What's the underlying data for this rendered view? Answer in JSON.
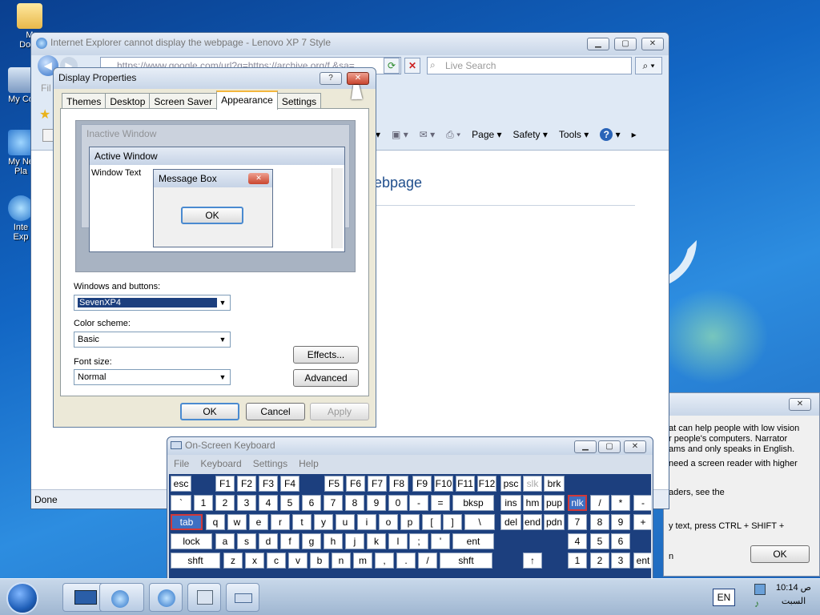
{
  "desktop": {
    "icons": [
      {
        "label": "My Documents",
        "short": "M\nDocu"
      },
      {
        "label": "My Computer",
        "short": "My Co"
      },
      {
        "label": "My Network Places",
        "short": "My Ne\nPla"
      },
      {
        "label": "Internet Explorer",
        "short": "Inte\nExp"
      }
    ]
  },
  "ie": {
    "title": "Internet Explorer cannot display the webpage - Lenovo XP 7 Style",
    "address": "https://www.google.com/url?q=https://archive.org/f &sa=",
    "search_placeholder": "Live Search",
    "file_menu_fragment": "Fil",
    "cmd": {
      "page": "Page",
      "safety": "Safety",
      "tools": "Tools",
      "help": "?"
    },
    "heading_fragment": "ebpage",
    "status": "Done"
  },
  "narrator": {
    "lines": [
      "at can help people with low vision",
      "r people's computers. Narrator",
      "ams and only speaks in English.",
      "need a screen reader with higher",
      "aders, see the",
      "y text, press CTRL + SHIFT +",
      "n"
    ],
    "ok_label": "OK",
    "close_label": "✕"
  },
  "display_properties": {
    "title": "Display Properties",
    "help_label": "?",
    "close_label": "✕",
    "tabs": [
      "Themes",
      "Desktop",
      "Screen Saver",
      "Appearance",
      "Settings"
    ],
    "active_tab": "Appearance",
    "preview": {
      "inactive_title": "Inactive Window",
      "active_title": "Active Window",
      "window_text": "Window Text",
      "message_title": "Message Box",
      "message_ok": "OK"
    },
    "windows_buttons_label": "Windows and buttons:",
    "windows_buttons_value": "SevenXP4",
    "color_scheme_label": "Color scheme:",
    "color_scheme_value": "Basic",
    "font_size_label": "Font size:",
    "font_size_value": "Normal",
    "effects_label": "Effects...",
    "advanced_label": "Advanced",
    "ok_label": "OK",
    "cancel_label": "Cancel",
    "apply_label": "Apply"
  },
  "osk": {
    "title": "On-Screen Keyboard",
    "menu": [
      "File",
      "Keyboard",
      "Settings",
      "Help"
    ],
    "rows": [
      [
        "esc",
        "F1",
        "F2",
        "F3",
        "F4",
        "F5",
        "F6",
        "F7",
        "F8",
        "F9",
        "F10",
        "F11",
        "F12",
        "psc",
        "slk",
        "brk"
      ],
      [
        "`",
        "1",
        "2",
        "3",
        "4",
        "5",
        "6",
        "7",
        "8",
        "9",
        "0",
        "-",
        "=",
        "bksp",
        "ins",
        "hm",
        "pup",
        "nlk",
        "/",
        "*",
        "-"
      ],
      [
        "tab",
        "q",
        "w",
        "e",
        "r",
        "t",
        "y",
        "u",
        "i",
        "o",
        "p",
        "[",
        "]",
        "\\",
        "del",
        "end",
        "pdn",
        "7",
        "8",
        "9",
        "+"
      ],
      [
        "lock",
        "a",
        "s",
        "d",
        "f",
        "g",
        "h",
        "j",
        "k",
        "l",
        ";",
        "'",
        "ent",
        "4",
        "5",
        "6"
      ],
      [
        "shft",
        "z",
        "x",
        "c",
        "v",
        "b",
        "n",
        "m",
        ",",
        ".",
        "/",
        "shft",
        "↑",
        "1",
        "2",
        "3",
        "ent"
      ]
    ]
  },
  "taskbar": {
    "language": "EN",
    "time": "10:14 ص",
    "day": "السبت"
  }
}
